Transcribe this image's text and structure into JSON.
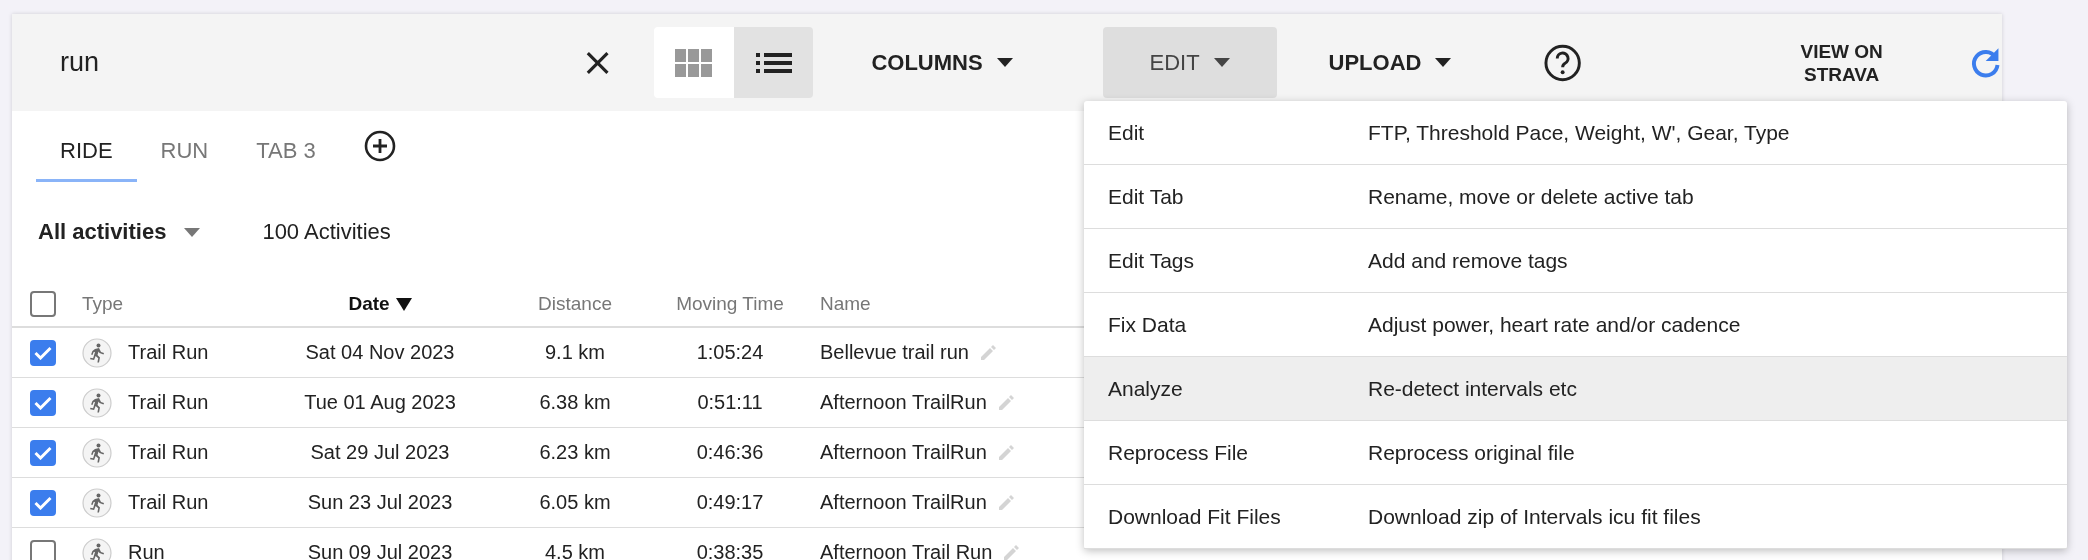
{
  "search": {
    "value": "run"
  },
  "view_toggle": [
    {
      "kind": "grid",
      "selected": false
    },
    {
      "kind": "list",
      "selected": true
    }
  ],
  "toolbar_buttons": [
    {
      "label": "COLUMNS",
      "open": false
    },
    {
      "label": "EDIT",
      "open": true
    },
    {
      "label": "UPLOAD",
      "open": false
    }
  ],
  "view_link": "VIEW ON STRAVA",
  "tabs": [
    {
      "label": "RIDE",
      "selected": true
    },
    {
      "label": "RUN",
      "selected": false
    },
    {
      "label": "TAB 3",
      "selected": false
    }
  ],
  "filter": {
    "label": "All activities"
  },
  "count": "100 Activities",
  "table": {
    "all_checked": false,
    "columns": [
      {
        "label": "Type",
        "sorted": false
      },
      {
        "label": "Date",
        "sorted": true
      },
      {
        "label": "Distance",
        "sorted": false
      },
      {
        "label": "Moving Time",
        "sorted": false
      },
      {
        "label": "Name",
        "sorted": false
      }
    ],
    "rows": [
      {
        "checked": true,
        "type": "Trail Run",
        "date": "Sat 04 Nov 2023",
        "distance": "9.1 km",
        "moving_time": "1:05:24",
        "name": "Bellevue trail run"
      },
      {
        "checked": true,
        "type": "Trail Run",
        "date": "Tue 01 Aug 2023",
        "distance": "6.38 km",
        "moving_time": "0:51:11",
        "name": "Afternoon TrailRun"
      },
      {
        "checked": true,
        "type": "Trail Run",
        "date": "Sat 29 Jul 2023",
        "distance": "6.23 km",
        "moving_time": "0:46:36",
        "name": "Afternoon TrailRun"
      },
      {
        "checked": true,
        "type": "Trail Run",
        "date": "Sun 23 Jul 2023",
        "distance": "6.05 km",
        "moving_time": "0:49:17",
        "name": "Afternoon TrailRun"
      },
      {
        "checked": false,
        "type": "Run",
        "date": "Sun 09 Jul 2023",
        "distance": "4.5 km",
        "moving_time": "0:38:35",
        "name": "Afternoon Trail Run"
      }
    ]
  },
  "menu": {
    "items": [
      {
        "label": "Edit",
        "description": "FTP, Threshold Pace, Weight, W', Gear, Type",
        "highlighted": false
      },
      {
        "label": "Edit Tab",
        "description": "Rename, move or delete active tab",
        "highlighted": false
      },
      {
        "label": "Edit Tags",
        "description": "Add and remove tags",
        "highlighted": false
      },
      {
        "label": "Fix Data",
        "description": "Adjust power, heart rate and/or cadence",
        "highlighted": false
      },
      {
        "label": "Analyze",
        "description": "Re-detect intervals etc",
        "highlighted": true
      },
      {
        "label": "Reprocess File",
        "description": "Reprocess original file",
        "highlighted": false
      },
      {
        "label": "Download Fit Files",
        "description": "Download zip of Intervals icu fit files",
        "highlighted": false
      }
    ]
  }
}
